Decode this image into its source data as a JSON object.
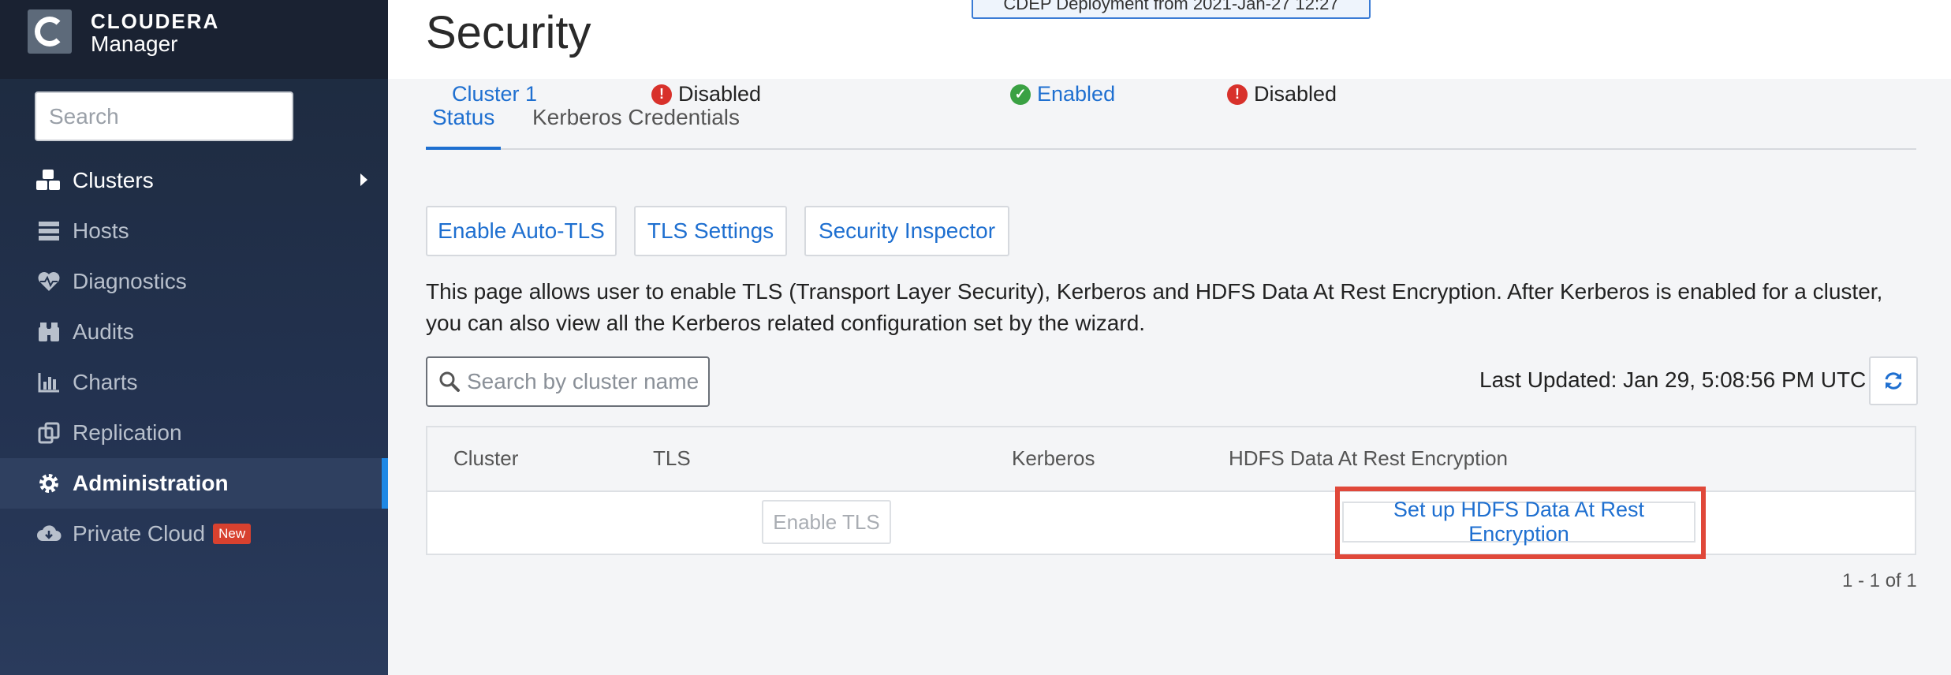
{
  "brand": {
    "name": "CLOUDERA",
    "product": "Manager"
  },
  "sidebar": {
    "search_placeholder": "Search",
    "items": [
      {
        "label": "Clusters",
        "icon": "cubes-icon"
      },
      {
        "label": "Hosts",
        "icon": "server-icon"
      },
      {
        "label": "Diagnostics",
        "icon": "heartbeat-icon"
      },
      {
        "label": "Audits",
        "icon": "binoculars-icon"
      },
      {
        "label": "Charts",
        "icon": "bar-chart-icon"
      },
      {
        "label": "Replication",
        "icon": "copy-icon"
      },
      {
        "label": "Administration",
        "icon": "gear-icon"
      },
      {
        "label": "Private Cloud",
        "icon": "cloud-download-icon",
        "badge": "New"
      }
    ],
    "active_item": "Administration"
  },
  "header": {
    "title": "Security",
    "deployment_tag": "CDEP Deployment from 2021-Jan-27 12:27"
  },
  "tabs": [
    {
      "label": "Status",
      "active": true
    },
    {
      "label": "Kerberos Credentials",
      "active": false
    }
  ],
  "actions": {
    "auto_tls": "Enable Auto-TLS",
    "tls_settings": "TLS Settings",
    "security_inspector": "Security Inspector"
  },
  "description": "This page allows user to enable TLS (Transport Layer Security), Kerberos and HDFS Data At Rest Encryption. After Kerberos is enabled for a cluster, you can also view all the Kerberos related configuration set by the wizard.",
  "cluster_search": {
    "placeholder": "Search by cluster name"
  },
  "last_updated": "Last Updated: Jan 29, 5:08:56 PM UTC",
  "table": {
    "columns": [
      "Cluster",
      "TLS",
      "Kerberos",
      "HDFS Data At Rest Encryption"
    ],
    "rows": [
      {
        "cluster": "Cluster 1",
        "tls_status": "Disabled",
        "tls_action": "Enable TLS",
        "kerberos_status": "Enabled",
        "hdfs_status": "Disabled",
        "hdfs_action": "Set up HDFS Data At Rest Encryption"
      }
    ]
  },
  "pagination": "1 - 1 of 1",
  "colors": {
    "accent": "#1e6fd0",
    "sidebar_bg": "#1d2a3d",
    "error": "#d8312b",
    "success": "#3aa143",
    "highlight": "#e0483a"
  }
}
